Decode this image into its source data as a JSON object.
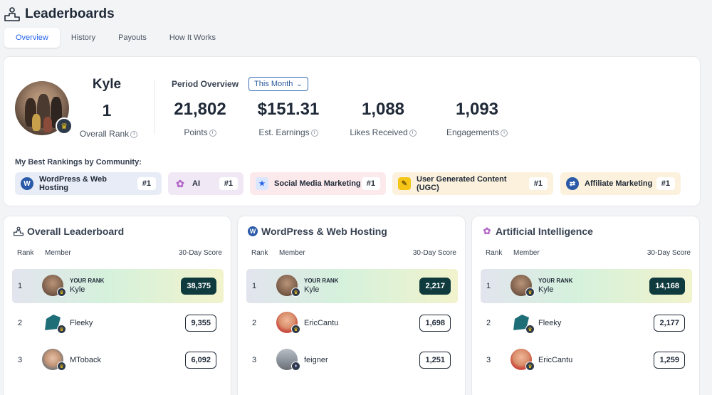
{
  "page": {
    "title": "Leaderboards"
  },
  "tabs": [
    "Overview",
    "History",
    "Payouts",
    "How It Works"
  ],
  "profile": {
    "name": "Kyle",
    "rank": "1",
    "rank_label": "Overall Rank",
    "period_title": "Period Overview",
    "period_select": "This Month",
    "stats": [
      {
        "value": "21,802",
        "label": "Points"
      },
      {
        "value": "$151.31",
        "label": "Est. Earnings"
      },
      {
        "value": "1,088",
        "label": "Likes Received"
      },
      {
        "value": "1,093",
        "label": "Engagements"
      }
    ],
    "best_label": "My Best Rankings by Community:",
    "communities": [
      {
        "label": "WordPress & Web Hosting",
        "rank": "#1",
        "icon": "wordpress-icon",
        "bg": "#e8ecf6"
      },
      {
        "label": "AI",
        "rank": "#1",
        "icon": "ai-flower-icon",
        "bg": "#f1e8f6"
      },
      {
        "label": "Social Media Marketing",
        "rank": "#1",
        "icon": "social-media-icon",
        "bg": "#fbe9ec"
      },
      {
        "label": "User Generated Content (UGC)",
        "rank": "#1",
        "icon": "pencil-icon",
        "bg": "#fbf1dc"
      },
      {
        "label": "Affiliate Marketing",
        "rank": "#1",
        "icon": "affiliate-icon",
        "bg": "#fbf1dc"
      }
    ]
  },
  "columns": {
    "rank": "Rank",
    "member": "Member",
    "score": "30-Day Score"
  },
  "your_rank_label": "YOUR RANK",
  "panels": [
    {
      "title": "Overall Leaderboard",
      "icon": "podium-icon",
      "rows": [
        {
          "rank": "1",
          "member": "Kyle",
          "score": "38,375",
          "me": true
        },
        {
          "rank": "2",
          "member": "Fleeky",
          "score": "9,355"
        },
        {
          "rank": "3",
          "member": "MToback",
          "score": "6,092"
        }
      ]
    },
    {
      "title": "WordPress & Web Hosting",
      "icon": "wordpress-icon",
      "rows": [
        {
          "rank": "1",
          "member": "Kyle",
          "score": "2,217",
          "me": true
        },
        {
          "rank": "2",
          "member": "EricCantu",
          "score": "1,698"
        },
        {
          "rank": "3",
          "member": "feigner",
          "score": "1,251"
        }
      ]
    },
    {
      "title": "Artificial Intelligence",
      "icon": "ai-flower-icon",
      "rows": [
        {
          "rank": "1",
          "member": "Kyle",
          "score": "14,168",
          "me": true
        },
        {
          "rank": "2",
          "member": "Fleeky",
          "score": "2,177"
        },
        {
          "rank": "3",
          "member": "EricCantu",
          "score": "1,259"
        }
      ]
    }
  ],
  "colors": {
    "accent": "#2563eb",
    "score_highlight": "#0f3b3e",
    "crown": "#facc15"
  }
}
